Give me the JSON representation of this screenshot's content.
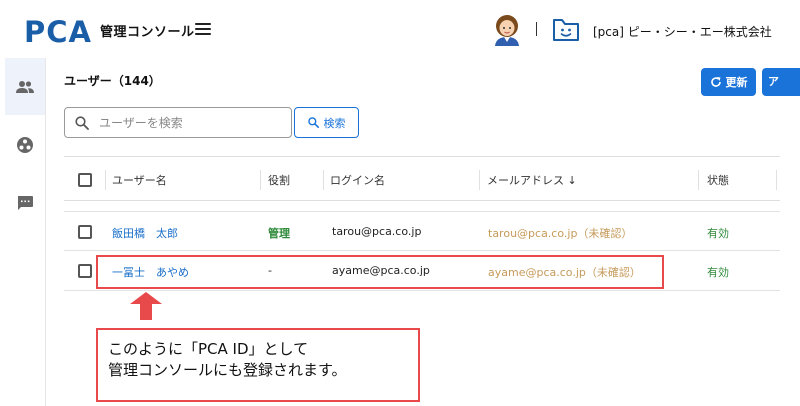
{
  "header": {
    "logo_text": "PCA",
    "app_title": "管理コンソール",
    "tenant_name": "[pca] ピー・シー・エー株式会社",
    "icons": [
      "hamburger-icon",
      "user-avatar",
      "tenant-icon"
    ]
  },
  "rail": {
    "items": [
      {
        "icon": "users-icon",
        "active": true
      },
      {
        "icon": "apps-icon",
        "active": false
      },
      {
        "icon": "chat-icon",
        "active": false
      }
    ]
  },
  "page": {
    "title": "ユーザー（144）",
    "refresh_label": "更新",
    "more_label": "ア"
  },
  "search": {
    "placeholder": "ユーザーを検索",
    "value": "",
    "button_label": "検索"
  },
  "table": {
    "columns": [
      "ユーザー名",
      "役割",
      "ログイン名",
      "メールアドレス ↓",
      "状態"
    ],
    "sort_column": "メールアドレス",
    "rows": [
      {
        "name": "飯田橋　太郎",
        "role": "管理",
        "login": "tarou@pca.co.jp",
        "email": "tarou@pca.co.jp（未確認）",
        "status": "有効"
      },
      {
        "name": "一冨士　あやめ",
        "role": "-",
        "login": "ayame@pca.co.jp",
        "email": "ayame@pca.co.jp（未確認）",
        "status": "有効"
      }
    ]
  },
  "callout": {
    "line1": "このように「PCA ID」として",
    "line2": "管理コンソールにも登録されます。"
  },
  "colors": {
    "primary": "#1a73d9",
    "link": "#1a6fc9",
    "success": "#2e8b3a",
    "unverified": "#c69a5a",
    "annotation": "#e8494b"
  }
}
